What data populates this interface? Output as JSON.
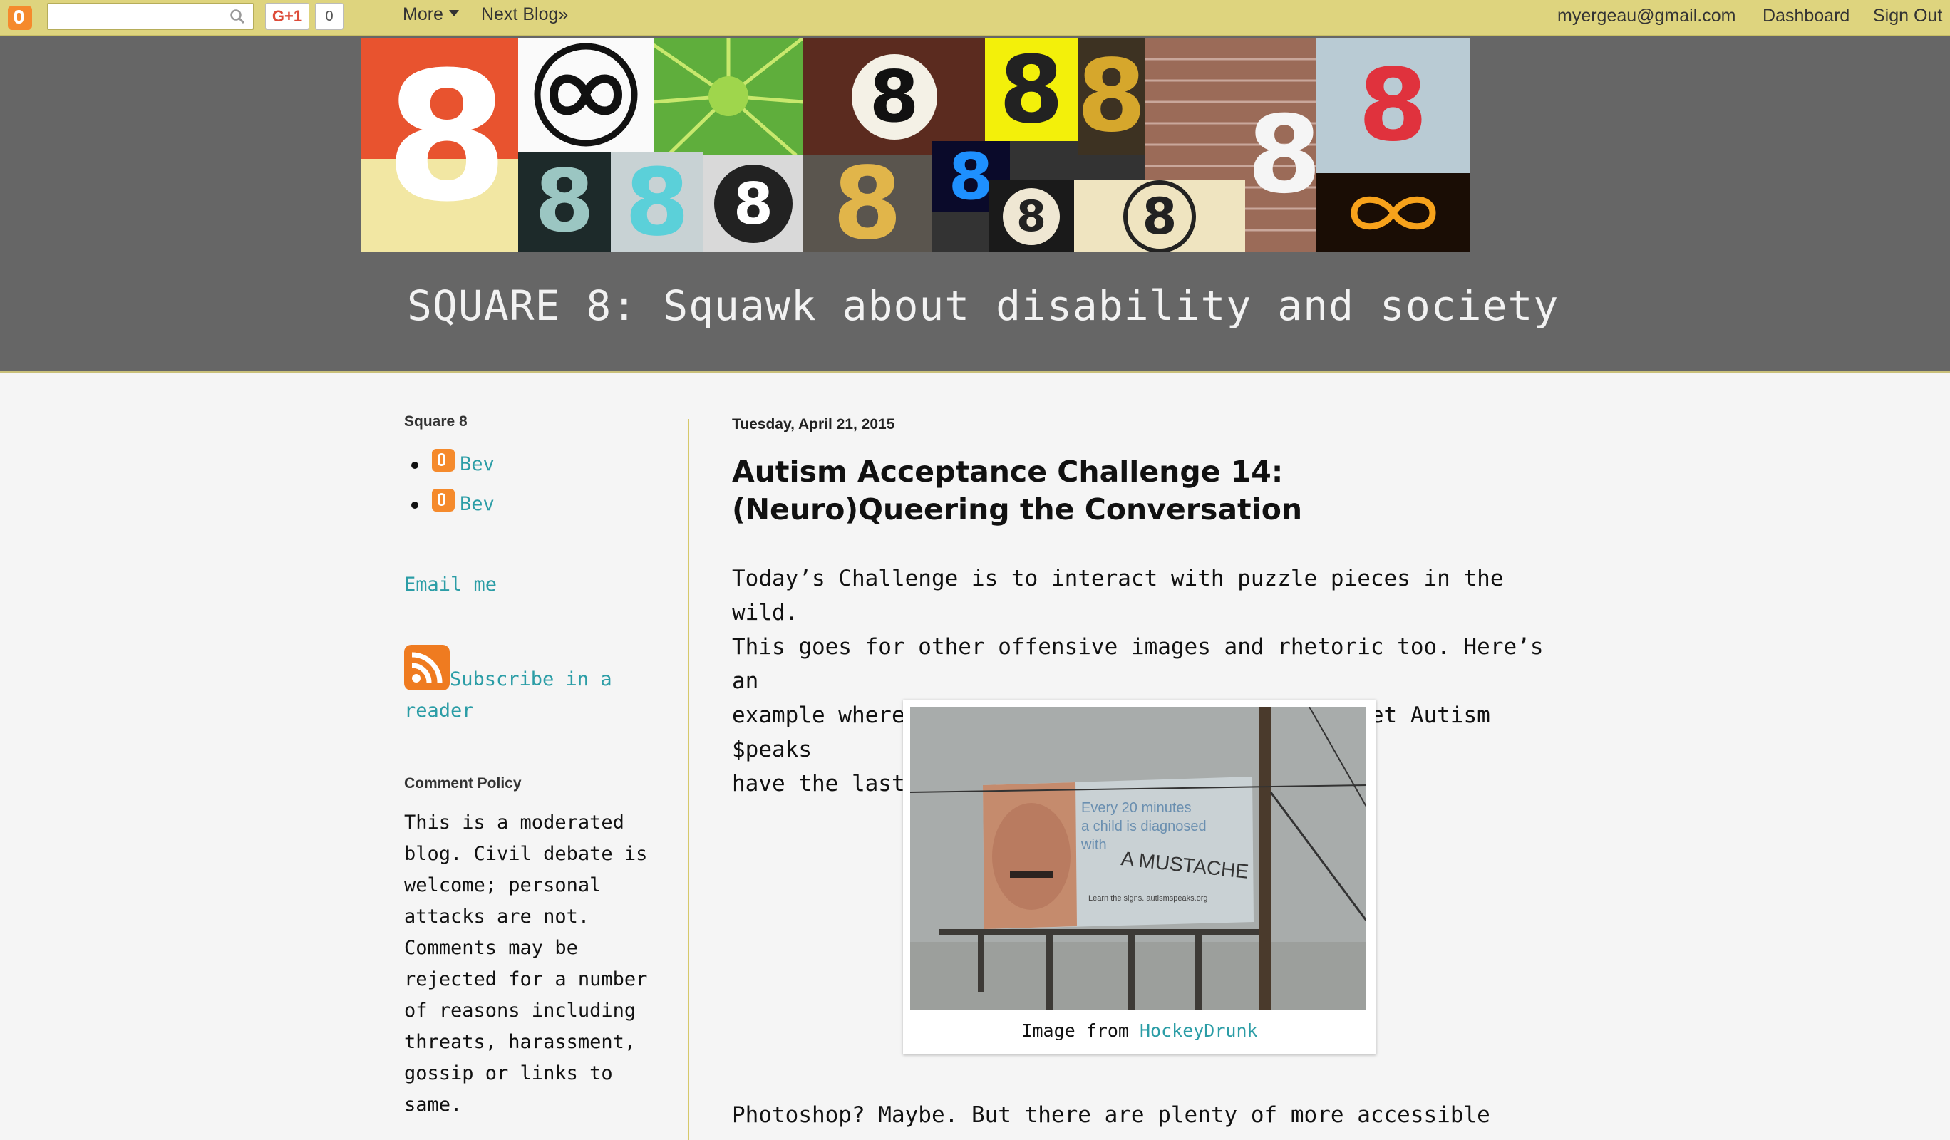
{
  "navbar": {
    "gplus_label": "G+1",
    "gplus_count": "0",
    "more_label": "More",
    "next_blog_label": "Next Blog»",
    "account_email": "myergeau@gmail.com",
    "dashboard_label": "Dashboard",
    "signout_label": "Sign Out"
  },
  "header": {
    "blog_title": "SQUARE 8: Squawk about disability and society"
  },
  "sidebar": {
    "square8_heading": "Square 8",
    "profiles": [
      {
        "name": "Bev"
      },
      {
        "name": "Bev"
      }
    ],
    "email_link": "Email me",
    "subscribe_link_line1": "Subscribe in a",
    "subscribe_link_line2": "reader",
    "comment_policy_heading": "Comment Policy",
    "comment_policy_text": "This is a moderated\nblog. Civil debate is\nwelcome; personal\nattacks are not.\nComments may be\nrejected for a number\nof reasons including\nthreats, harassment,\ngossip or links to\nsame."
  },
  "post": {
    "date": "Tuesday, April 21, 2015",
    "title": "Autism Acceptance Challenge 14: (Neuro)Queering the Conversation",
    "body": "Today’s Challenge is to interact with puzzle pieces in the wild.\nThis goes for other offensive images and rhetoric too. Here’s an\nexample where a graffiti artist decided not to let Autism $peaks\nhave the last word.",
    "image_caption_prefix": "Image from ",
    "image_caption_link": "HockeyDrunk",
    "billboard_text_line1": "Every 20 minutes",
    "billboard_text_line2": "a child is diagnosed",
    "billboard_text_line3": "with",
    "billboard_graffiti": "A MUSTACHE",
    "billboard_footer": "Learn the signs. autismspeaks.org",
    "last_line": "Photoshop? Maybe. But there are plenty of more accessible"
  },
  "colors": {
    "navbar_bg": "#ded47e",
    "header_bg": "#666666",
    "link": "#2b9da6",
    "blogger_orange": "#f58a2c",
    "divider": "#d6c86a"
  }
}
